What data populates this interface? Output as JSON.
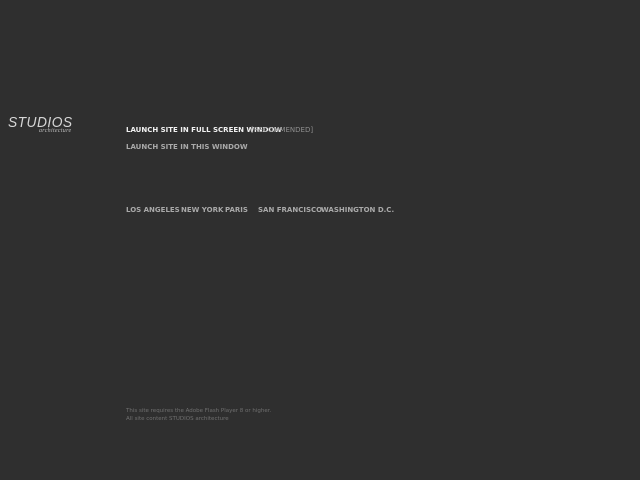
{
  "brand": {
    "name": "STUDIOS",
    "tagline": "architecture"
  },
  "launch": {
    "fullscreen_label": "LAUNCH SITE IN FULL SCREEN WINDOW",
    "fullscreen_note": "[RECOMMENDED]",
    "window_label": "LAUNCH SITE IN THIS WINDOW"
  },
  "cities": [
    "LOS ANGELES",
    "NEW YORK",
    "PARIS",
    "SAN FRANCISCO",
    "WASHINGTON D.C."
  ],
  "footer": {
    "requirement": "This site requires the Adobe Flash Player 8 or higher.",
    "copyright": "All site content  STUDIOS architecture"
  },
  "colors": {
    "background": "#2f2f2f",
    "primary_link": "#f1f1f1",
    "secondary_link": "#a9a9a9",
    "footer_text": "#707070"
  }
}
